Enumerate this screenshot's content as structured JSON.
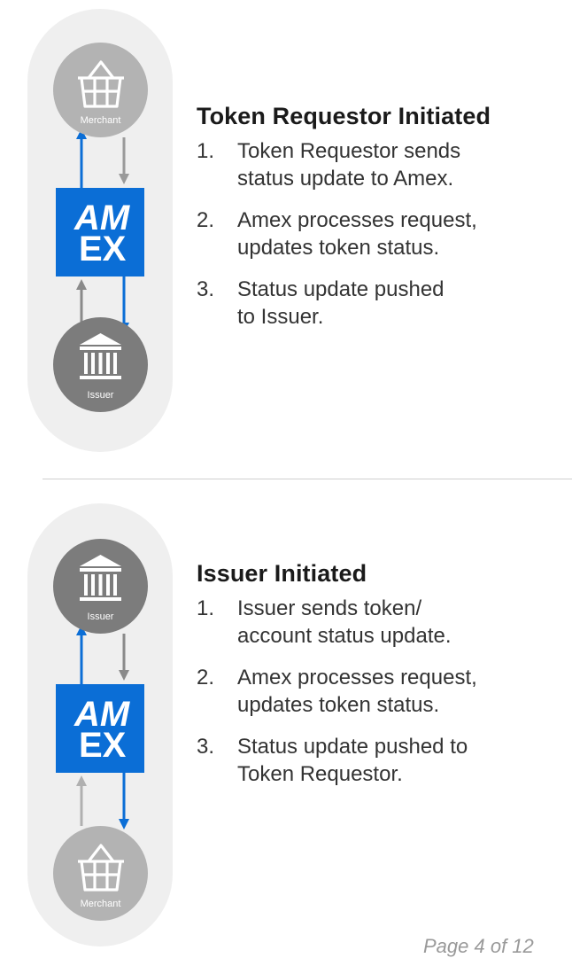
{
  "colors": {
    "amex_blue": "#0b6ed6",
    "arrow_gray": "#8f8f8f",
    "merchant_node": "#b3b3b3",
    "issuer_node": "#7c7c7c",
    "pill_background": "#efefef"
  },
  "logo_text": {
    "line1": "AM",
    "line2": "EX"
  },
  "section1": {
    "title": "Token Requestor Initiated",
    "top_node": {
      "label": "Merchant",
      "icon": "basket-icon"
    },
    "bottom_node": {
      "label": "Issuer",
      "icon": "bank-icon"
    },
    "steps": [
      {
        "num": "1.",
        "line1": "Token Requestor sends",
        "line2": "status update to Amex."
      },
      {
        "num": "2.",
        "line1": "Amex processes request,",
        "line2": "updates token status."
      },
      {
        "num": "3.",
        "line1": "Status update pushed",
        "line2": "to Issuer."
      }
    ]
  },
  "section2": {
    "title": "Issuer Initiated",
    "top_node": {
      "label": "Issuer",
      "icon": "bank-icon"
    },
    "bottom_node": {
      "label": "Merchant",
      "icon": "basket-icon"
    },
    "steps": [
      {
        "num": "1.",
        "line1": "Issuer sends token/",
        "line2": "account status update."
      },
      {
        "num": "2.",
        "line1": "Amex processes request,",
        "line2": "updates token status."
      },
      {
        "num": "3.",
        "line1": "Status update pushed to",
        "line2": "Token Requestor."
      }
    ]
  },
  "footer": {
    "page_label": "Page 4 of 12"
  }
}
